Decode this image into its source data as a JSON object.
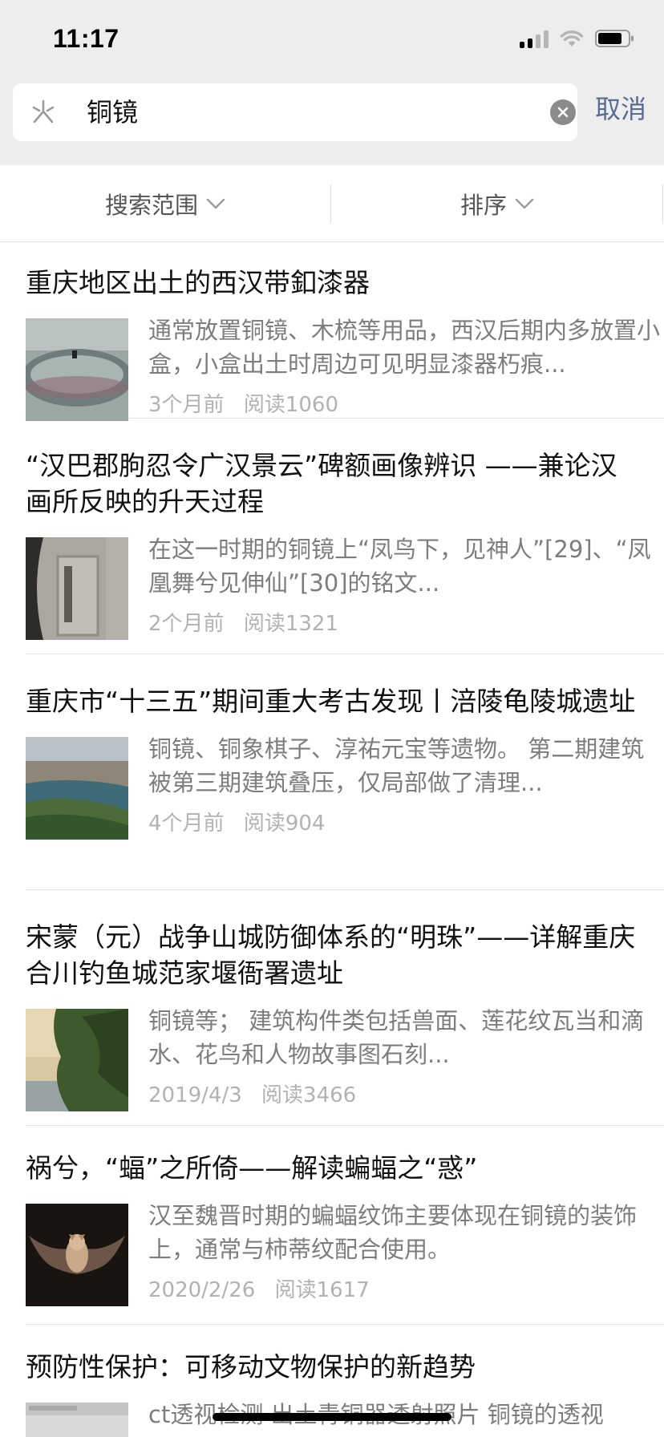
{
  "status_bar": {
    "time": "11:17",
    "icons": [
      "cellular-signal-icon",
      "wifi-icon",
      "battery-icon"
    ]
  },
  "search": {
    "icon": "search-icon",
    "query": "铜镜",
    "clear_icon": "clear-icon",
    "cancel_label": "取消"
  },
  "filters": {
    "scope_label": "搜索范围",
    "sort_label": "排序"
  },
  "colors": {
    "header_bg": "#ededed",
    "link_blue": "#576b95",
    "snippet_gray": "#7d7d7d",
    "meta_gray": "#b2b2b2"
  },
  "results": [
    {
      "title": "重庆地区出土的西汉带釦漆器",
      "snippet": "通常放置铜镜、木梳等用品，西汉后期内多放置小盒，小盒出土时周边可见明显漆器朽痕...",
      "time": "3个月前",
      "reads": "阅读1060",
      "thumb": "lacquer-ring-thumbnail"
    },
    {
      "title": "“汉巴郡朐忍令广汉景云”碑额画像辨识 ——兼论汉画所反映的升天过程",
      "snippet": "在这一时期的铜镜上“凤鸟下，见神人”[29]、“凤凰舞兮见伸仙”[30]的铭文...",
      "time": "2个月前",
      "reads": "阅读1321",
      "thumb": "stone-stele-thumbnail"
    },
    {
      "title": "重庆市“十三五”期间重大考古发现丨涪陵龟陵城遗址",
      "snippet": "铜镜、铜象棋子、淳祐元宝等遗物。 第二期建筑被第三期建筑叠压，仅局部做了清理...",
      "time": "4个月前",
      "reads": "阅读904",
      "thumb": "aerial-river-city-thumbnail"
    },
    {
      "title": "宋蒙（元）战争山城防御体系的“明珠”——详解重庆合川钓鱼城范家堰衙署遗址",
      "snippet": "铜镜等； 建筑构件类包括兽面、莲花纹瓦当和滴水、花鸟和人物故事图石刻...",
      "time": "2019/4/3",
      "reads": "阅读3466",
      "thumb": "cliff-sunset-thumbnail"
    },
    {
      "title": "祸兮，“蝠”之所倚——解读蝙蝠之“惑”",
      "snippet": "汉至魏晋时期的蝙蝠纹饰主要体现在铜镜的装饰上，通常与柿蒂纹配合使用。",
      "time": "2020/2/26",
      "reads": "阅读1617",
      "thumb": "bat-photo-thumbnail"
    },
    {
      "title": "预防性保护：可移动文物保护的新趋势",
      "snippet": "ct透视检测 出土青铜器透射照片 铜镜的透视",
      "time": "",
      "reads": "",
      "thumb": "ct-scan-thumbnail"
    }
  ]
}
